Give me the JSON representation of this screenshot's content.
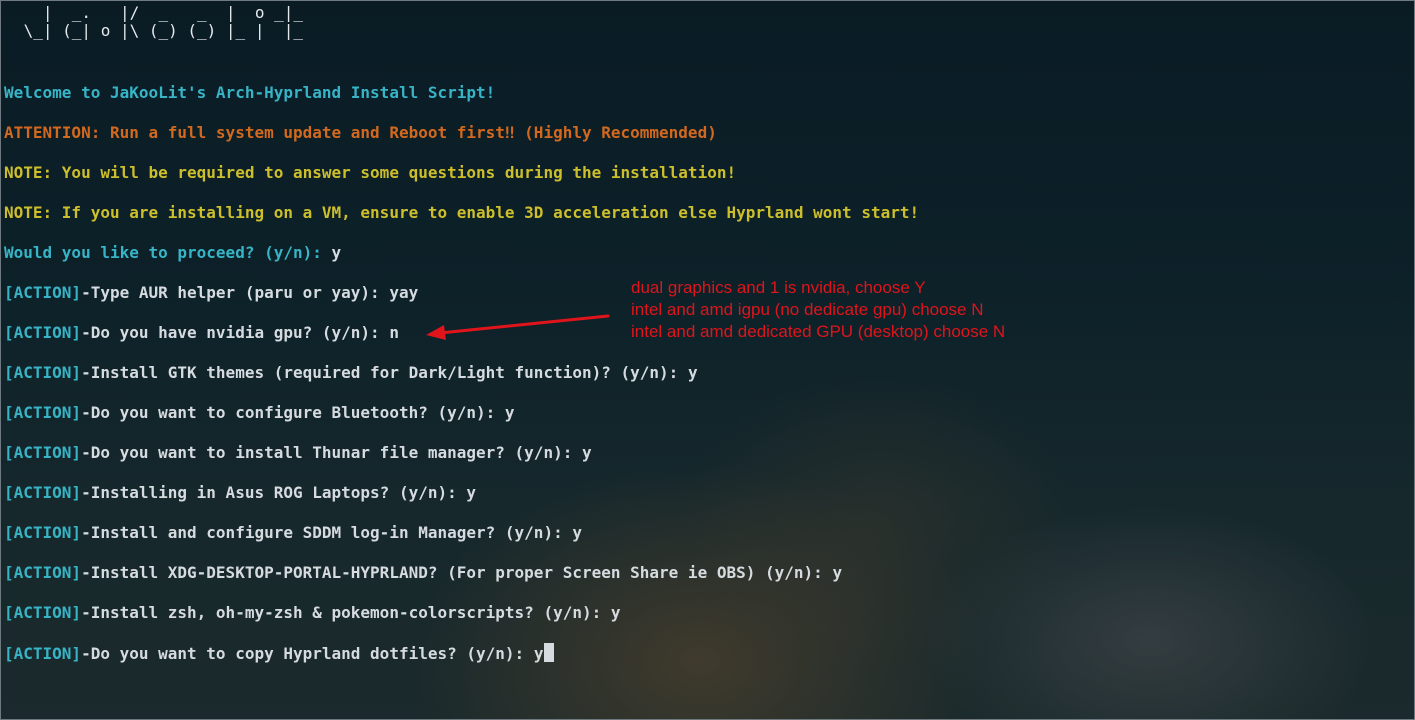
{
  "banner": {
    "line1": "   |  _.   |/  _   _  |  o _|_",
    "line2": " \\_| (_| o |\\ (_) (_) |_ |  |_"
  },
  "intro": {
    "welcome": "Welcome to JaKooLit's Arch-Hyprland Install Script!",
    "attention": "ATTENTION: Run a full system update and Reboot first‼ (Highly Recommended)",
    "note1": "NOTE: You will be required to answer some questions during the installation!",
    "note2": "NOTE: If you are installing on a VM, ensure to enable 3D acceleration else Hyprland wont start!",
    "proceed_question": "Would you like to proceed? (y/n):",
    "proceed_answer": "y"
  },
  "action_tag": "[ACTION]",
  "actions": [
    {
      "text": "-Type AUR helper (paru or yay):",
      "answer": "yay"
    },
    {
      "text": "-Do you have nvidia gpu? (y/n):",
      "answer": "n"
    },
    {
      "text": "-Install GTK themes (required for Dark/Light function)? (y/n):",
      "answer": "y"
    },
    {
      "text": "-Do you want to configure Bluetooth? (y/n):",
      "answer": "y"
    },
    {
      "text": "-Do you want to install Thunar file manager? (y/n):",
      "answer": "y"
    },
    {
      "text": "-Installing in Asus ROG Laptops? (y/n):",
      "answer": "y"
    },
    {
      "text": "-Install and configure SDDM log-in Manager? (y/n):",
      "answer": "y"
    },
    {
      "text": "-Install XDG-DESKTOP-PORTAL-HYPRLAND? (For proper Screen Share ie OBS) (y/n):",
      "answer": "y"
    },
    {
      "text": "-Install zsh, oh-my-zsh & pokemon-colorscripts? (y/n):",
      "answer": "y"
    },
    {
      "text": "-Do you want to copy Hyprland dotfiles? (y/n):",
      "answer": "y"
    }
  ],
  "annotation": {
    "line1": "dual graphics and 1 is nvidia, choose Y",
    "line2": "intel and amd igpu (no dedicate gpu) choose N",
    "line3": "intel and amd dedicated GPU (desktop) choose N"
  },
  "colors": {
    "cyan": "#37b4c6",
    "orange": "#d2691e",
    "yellow": "#cdbf2c",
    "annotation_red": "#e0141b"
  }
}
